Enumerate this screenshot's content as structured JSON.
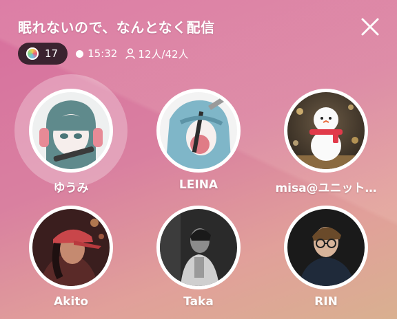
{
  "header": {
    "title": "眠れないので、なんとなく配信",
    "badge_count": "17",
    "elapsed_time": "15:32",
    "listeners": "12人/42人"
  },
  "members": [
    {
      "name": "ゆうみ",
      "avatar": "anime-girl-headphones-avatar",
      "speaking": true
    },
    {
      "name": "LEINA",
      "avatar": "anime-girl-blue-hair-avatar",
      "speaking": false
    },
    {
      "name": "misa@ユニット…",
      "avatar": "snowman-avatar",
      "speaking": false
    },
    {
      "name": "Akito",
      "avatar": "woman-red-cap-photo-avatar",
      "speaking": false
    },
    {
      "name": "Taka",
      "avatar": "monochrome-man-photo-avatar",
      "speaking": false
    },
    {
      "name": "RIN",
      "avatar": "man-glasses-photo-avatar",
      "speaking": false
    }
  ],
  "icons": [
    "close-icon",
    "rainbow-coin-icon",
    "live-dot-icon",
    "person-icon"
  ]
}
